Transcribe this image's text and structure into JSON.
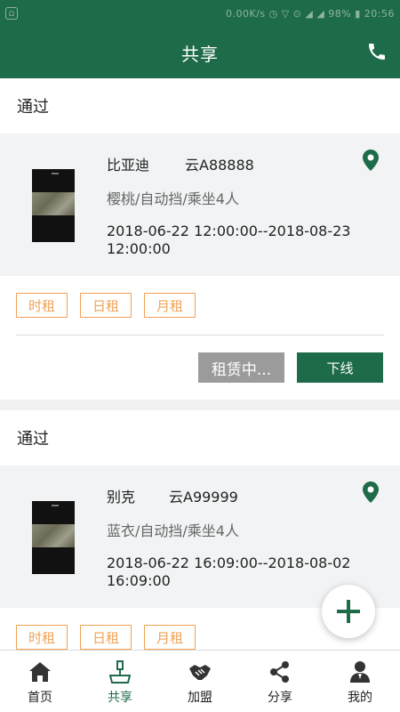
{
  "status_bar": {
    "left_badge": "Ω",
    "right_text": "0.00K/s ◷ ▽ ⊙ ◢ ◢ 98% ▮ 20:56"
  },
  "header": {
    "title": "共享"
  },
  "cards": [
    {
      "status": "通过",
      "car_name": "比亚迪",
      "plate": "云A88888",
      "specs": "樱桃/自动挡/乘坐4人",
      "period": "2018-06-22 12:00:00--2018-08-23 12:00:00",
      "tags": [
        "时租",
        "日租",
        "月租"
      ],
      "renting_label": "租赁中...",
      "offline_label": "下线"
    },
    {
      "status": "通过",
      "car_name": "别克",
      "plate": "云A99999",
      "specs": "蓝衣/自动挡/乘坐4人",
      "period": "2018-06-22 16:09:00--2018-08-02 16:09:00",
      "tags": [
        "时租",
        "日租",
        "月租"
      ]
    }
  ],
  "tabbar": {
    "items": [
      {
        "label": "首页",
        "icon": "home-icon"
      },
      {
        "label": "共享",
        "icon": "share-car-icon"
      },
      {
        "label": "加盟",
        "icon": "handshake-icon"
      },
      {
        "label": "分享",
        "icon": "share-icon"
      },
      {
        "label": "我的",
        "icon": "user-icon"
      }
    ],
    "active_index": 1
  },
  "colors": {
    "primary": "#1e6b49",
    "tag_orange": "#f0a255",
    "renting_gray": "#9b9b9b"
  }
}
